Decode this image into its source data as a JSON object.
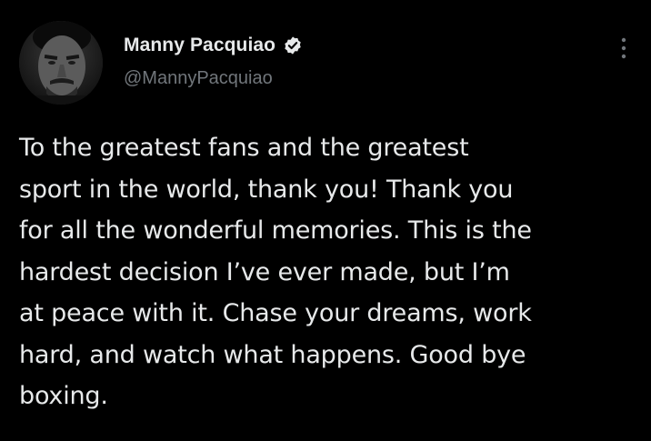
{
  "tweet": {
    "author": {
      "display_name": "Manny Pacquiao",
      "handle": "@MannyPacquiao",
      "verified": true,
      "avatar_icon": "avatar-photo"
    },
    "text": "To the greatest fans and the greatest\nsport in the world, thank you! Thank you\nfor all the wonderful memories. This is the\nhardest decision I’ve ever made, but I’m\nat peace with it. Chase your dreams, work\nhard, and watch what happens. Good bye\nboxing.",
    "menu_icon": "more-vertical-icon"
  },
  "colors": {
    "background": "#000000",
    "text_primary": "#e7e9ea",
    "text_secondary": "#71767b"
  }
}
